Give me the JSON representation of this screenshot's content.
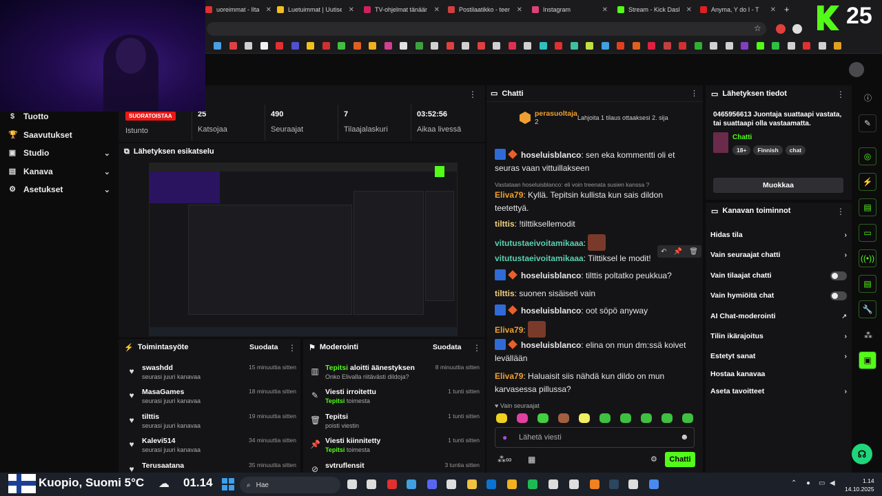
{
  "browser": {
    "tabs": [
      {
        "label": "uoreimmat - Ilta-Sa",
        "color": "#e03030"
      },
      {
        "label": "Luetuimmat | Uutiset",
        "color": "#f0c020"
      },
      {
        "label": "TV-ohjelmat tänään |",
        "color": "#d02060"
      },
      {
        "label": "Postilaatikko - teemu",
        "color": "#d04040"
      },
      {
        "label": "Instagram",
        "color": "#e0407a"
      },
      {
        "label": "Stream - Kick Dashbo",
        "color": "#53fc18"
      },
      {
        "label": "Anyma, Y do I - T",
        "color": "#e02020"
      }
    ],
    "new_tab": "+",
    "window_controls": [
      "—",
      "▢",
      "✕"
    ]
  },
  "overlay": {
    "kick_count": "25"
  },
  "sidebar": {
    "items": [
      {
        "label": "Tuotto",
        "icon": "dollar-icon",
        "glyph": "$",
        "chevron": false
      },
      {
        "label": "Saavutukset",
        "icon": "trophy-icon",
        "glyph": "🏆",
        "chevron": false
      },
      {
        "label": "Studio",
        "icon": "video-icon",
        "glyph": "▣",
        "chevron": true
      },
      {
        "label": "Kanava",
        "icon": "tv-icon",
        "glyph": "▤",
        "chevron": true
      },
      {
        "label": "Asetukset",
        "icon": "gear-icon",
        "glyph": "⚙",
        "chevron": true
      }
    ]
  },
  "stats": {
    "live_badge": "SUORATOISTAA",
    "session_label": "Istunto",
    "viewers_value": "25",
    "viewers_label": "Katsojaa",
    "followers_value": "490",
    "followers_label": "Seuraajat",
    "subs_value": "7",
    "subs_label": "Tilaajalaskuri",
    "uptime_value": "03:52:56",
    "uptime_label": "Aikaa livessä",
    "menu": "⋮"
  },
  "preview": {
    "title": "Lähetyksen esikatselu"
  },
  "activity": {
    "title": "Toimintasyöte",
    "filter": "Suodata",
    "rows": [
      {
        "name": "swashdd",
        "sub": "seurasi juuri kanavaa",
        "time": "15 minuuttia sitten"
      },
      {
        "name": "MasaGames",
        "sub": "seurasi juuri kanavaa",
        "time": "18 minuuttia sitten"
      },
      {
        "name": "tilttis",
        "sub": "seurasi juuri kanavaa",
        "time": "19 minuuttia sitten"
      },
      {
        "name": "Kalevi514",
        "sub": "seurasi juuri kanavaa",
        "time": "34 minuuttia sitten"
      },
      {
        "name": "Terusaatana",
        "sub": "",
        "time": "35 minuuttia sitten"
      }
    ]
  },
  "moderation": {
    "title": "Moderointi",
    "filter": "Suodata",
    "rows": [
      {
        "icon": "poll-icon",
        "glyph": "▥",
        "name_green": "Tepitsi",
        "name": " aloitti äänestyksen",
        "sub_green": "",
        "sub": "Onko Elivalla riitävästi dildoja?",
        "time": "8 minuuttia sitten"
      },
      {
        "icon": "unpin-icon",
        "glyph": "✎",
        "name_green": "",
        "name": "Viesti irroitettu",
        "sub_green": "Tepitsi",
        "sub": " toimesta",
        "time": "1 tunti sitten"
      },
      {
        "icon": "trash-icon",
        "glyph": "🗑",
        "name_green": "",
        "name": "Tepitsi",
        "sub_green": "",
        "sub": "poisti viestin",
        "time": "1 tunti sitten"
      },
      {
        "icon": "pin-icon",
        "glyph": "📌",
        "name_green": "",
        "name": "Viesti kiinnitetty",
        "sub_green": "Tepitsi",
        "sub": " toimesta",
        "time": "1 tunti sitten"
      },
      {
        "icon": "ban-icon",
        "glyph": "⊘",
        "name_green": "",
        "name": "svtruflensit",
        "sub_green": "",
        "sub": "",
        "time": "3 tuntia sitten"
      }
    ]
  },
  "chat": {
    "title": "Chatti",
    "pinned_user": "perasuoltaja",
    "pinned_count": "2",
    "pinned_gift": "Lahjoita 1 tilaus ottaaksesi 2. sija",
    "messages": [
      {
        "user": "hoseluisblanco",
        "color": "#e8e8ea",
        "badges": true,
        "text": "sen eka kommentti oli et seuras vaan vittuillakseen",
        "emote": false
      },
      {
        "user": "Eliva79",
        "color": "#f0a030",
        "badges": false,
        "reply": "Vastataan hoseluisblanco: eli voin treenata susien kanssa ?",
        "text": "Kyllä. Tepitsin kullista kun sais dildon teetettyä.",
        "emote": false
      },
      {
        "user": "tilttis",
        "color": "#f0d080",
        "badges": false,
        "text": "!tilttiksellemodit",
        "emote": false
      },
      {
        "user": "vitutustaeivoitamikaaa",
        "color": "#5ad0b0",
        "badges": false,
        "text": "",
        "emote": true
      },
      {
        "user": "vitutustaeivoitamikaaa",
        "color": "#5ad0b0",
        "badges": false,
        "text": "Tilttiksel le modit!",
        "emote": false
      },
      {
        "user": "hoseluisblanco",
        "color": "#e8e8ea",
        "badges": true,
        "text": "tilttis poltatko peukkua?",
        "emote": false
      },
      {
        "user": "tilttis",
        "color": "#f0d080",
        "badges": false,
        "text": "suonen sisäiseti vain",
        "emote": false
      },
      {
        "user": "hoseluisblanco",
        "color": "#e8e8ea",
        "badges": true,
        "text": "oot söpö anyway",
        "emote": false
      },
      {
        "user": "Eliva79",
        "color": "#f0a030",
        "badges": false,
        "text": "",
        "emote": true
      },
      {
        "user": "hoseluisblanco",
        "color": "#e8e8ea",
        "badges": true,
        "text": "elina on mun dm:ssä koivet levällään",
        "emote": false
      },
      {
        "user": "Eliva79",
        "color": "#f0a030",
        "badges": false,
        "text": "Haluaisit siis nähdä kun dildo on mun karvasessa pillussa?",
        "emote": false
      }
    ],
    "followers_only": "Vain seuraajat",
    "input_placeholder": "Lähetä viesti",
    "send_label": "Chatti"
  },
  "stream_info": {
    "title": "Lähetyksen tiedot",
    "stream_title": "0465956613 Juontaja suattaapi vastata, tai suattaapi olla vastaamatta.",
    "category": "Chatti",
    "tags": [
      "18+",
      "Finnish",
      "chat"
    ],
    "edit_label": "Muokkaa"
  },
  "channel_actions": {
    "title": "Kanavan toiminnot",
    "rows": [
      {
        "label": "Hidas tila",
        "kind": "chevron"
      },
      {
        "label": "Vain seuraajat chatti",
        "kind": "chevron"
      },
      {
        "label": "Vain tilaajat chatti",
        "kind": "toggle"
      },
      {
        "label": "Vain hymiöitä chat",
        "kind": "toggle"
      },
      {
        "label": "AI Chat-moderointi",
        "kind": "external"
      },
      {
        "label": "Tilin ikärajoitus",
        "kind": "chevron"
      },
      {
        "label": "Estetyt sanat",
        "kind": "chevron"
      },
      {
        "label": "Hostaa kanavaa",
        "kind": "none"
      },
      {
        "label": "Aseta tavoitteet",
        "kind": "chevron"
      }
    ]
  },
  "taskbar": {
    "location": "Kuopio, Suomi 5°C",
    "time_big": "01.14",
    "search_placeholder": "Hae",
    "clock_time": "1.14",
    "clock_date": "14.10.2025"
  },
  "colors": {
    "kick_green": "#53fc18",
    "live_red": "#e91916",
    "panel": "#141416"
  }
}
